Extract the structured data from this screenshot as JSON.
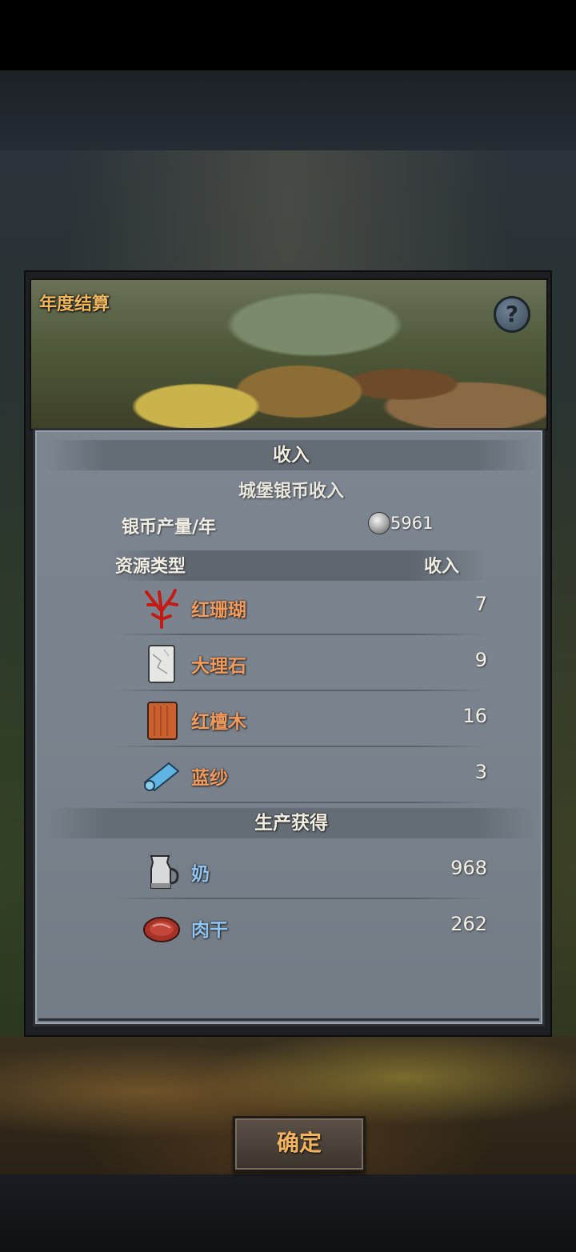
{
  "dialog": {
    "title": "年度结算",
    "help_symbol": "?"
  },
  "income": {
    "header": "收入",
    "castle_subtitle": "城堡银币收入",
    "silver_label": "银币产量/年",
    "silver_value": "5961",
    "col_type": "资源类型",
    "col_income": "收入",
    "resources": [
      {
        "name": "红珊瑚",
        "value": "7",
        "icon": "red-coral-icon"
      },
      {
        "name": "大理石",
        "value": "9",
        "icon": "marble-icon"
      },
      {
        "name": "红檀木",
        "value": "16",
        "icon": "red-sandalwood-icon"
      },
      {
        "name": "蓝纱",
        "value": "3",
        "icon": "blue-gauze-icon"
      }
    ]
  },
  "production": {
    "header": "生产获得",
    "items": [
      {
        "name": "奶",
        "value": "968",
        "icon": "milk-jug-icon"
      },
      {
        "name": "肉干",
        "value": "262",
        "icon": "jerky-icon"
      }
    ]
  },
  "confirm_label": "确定",
  "colors": {
    "resource_name": "#f19a5d",
    "product_name": "#8fc3f2",
    "confirm_text": "#f3b45e",
    "title_text": "#f0b85a"
  }
}
